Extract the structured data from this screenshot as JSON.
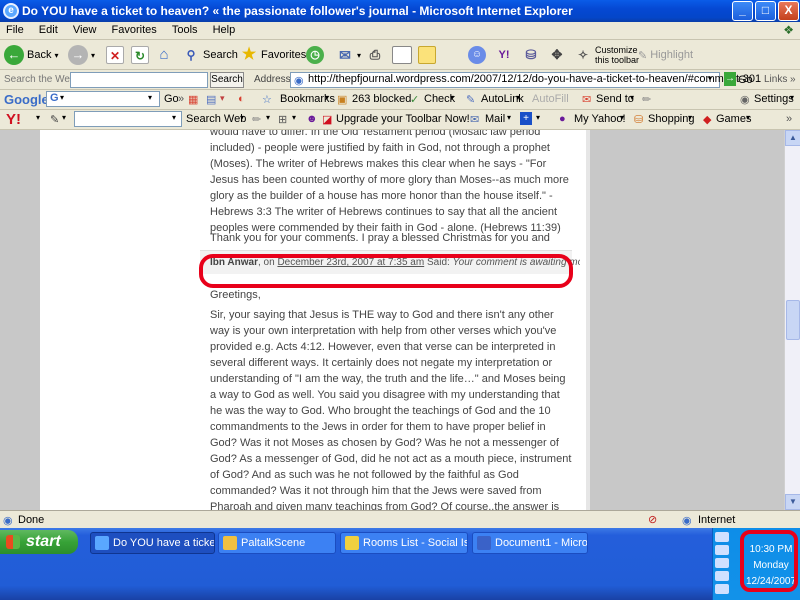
{
  "window": {
    "title": "Do YOU have a ticket to heaven? « the passionate follower's journal - Microsoft Internet Explorer",
    "min": "_",
    "max": "□",
    "close": "X"
  },
  "menu": [
    "File",
    "Edit",
    "View",
    "Favorites",
    "Tools",
    "Help"
  ],
  "toolbar": {
    "back": "Back",
    "search": "Search",
    "favorites": "Favorites",
    "customize_line1": "Customize",
    "customize_line2": "this toolbar",
    "highlight": "Highlight"
  },
  "address": {
    "search_web_label": "Search the Web",
    "search_button": "Search",
    "address_label": "Address",
    "url": "http://thepfjournal.wordpress.com/2007/12/12/do-you-have-a-ticket-to-heaven/#comment-301",
    "go": "Go",
    "links": "Links"
  },
  "google_bar": {
    "logo": "Google",
    "go": "Go",
    "bookmarks": "Bookmarks",
    "blocked": "263 blocked",
    "check": "Check",
    "autolink": "AutoLink",
    "autofill": "AutoFill",
    "send_to": "Send to",
    "settings": "Settings"
  },
  "yahoo_bar": {
    "logo": "Y!",
    "search_web": "Search Web",
    "upgrade": "Upgrade your Toolbar Now!",
    "mail": "Mail",
    "my_yahoo": "My Yahoo!",
    "shopping": "Shopping",
    "games": "Games"
  },
  "content": {
    "p1": "would have to differ. In the Old Testament period (Mosaic law period included) - people were justified by faith in God, not through a prophet (Moses). The writer of Hebrews makes this clear when he says - \"For Jesus has been counted worthy of more glory than Moses--as much more glory as the builder of a house has more honor than the house itself.\" - Hebrews 3:3 The writer of Hebrews continues to say that all the ancient peoples were commended by their faith in God - alone. (Hebrews 11:39)",
    "thanks": "Thank you for your comments. I pray a blessed Christmas for you and yours…",
    "comment": {
      "author": "Ibn Anwar",
      "on": ", on",
      "date": "December 23rd, 2007 at 7:35 am",
      "said": "Said:",
      "awaiting": "Your comment is awaiting moderation."
    },
    "greeting": "Greetings,",
    "body": "Sir, your saying that Jesus is THE way to God and there isn't any other way is your own interpretation with help from other verses which you've provided e.g. Acts 4:12. However, even that verse can be interpreted in several different ways. It certainly does not negate my interpretation or understanding of \"I am the way, the truth and the life…\" and Moses being a way to God as well. You said you disagree with my understanding that he was the way to God. Who brought the teachings of God and the 10 commandments to the Jews in order for them to have proper belief in God? Was it not Moses as chosen by God? Was he not a messenger of God? As a messenger of God, did he not act as a mouth piece, instrument of God? And as such was he not followed by the faithful as God commanded? Was it not through him that the Jews were saved from Pharoah and given many teachings from God? Of course..the answer is yes, yes, yes, yes and yes. So my saying that Moses was THE way to God in his own dispensation is indeed right on the mark. Likewise, through the teachings of Jesus which he got from his God and Father who is also our God and Father as he"
  },
  "status": {
    "done": "Done",
    "zone": "Internet"
  },
  "taskbar": {
    "start": "start",
    "tasks": [
      "Do YOU have a ticket...",
      "PaltalkScene",
      "Rooms List - Social Is...",
      "Document1 - Microsof..."
    ],
    "clock": {
      "time": "10:30 PM",
      "day": "Monday",
      "date": "12/24/2007"
    }
  },
  "colors": {
    "highlight_red": "#e8001a",
    "title_blue": "#0548d3",
    "taskbar_blue": "#245edb"
  }
}
